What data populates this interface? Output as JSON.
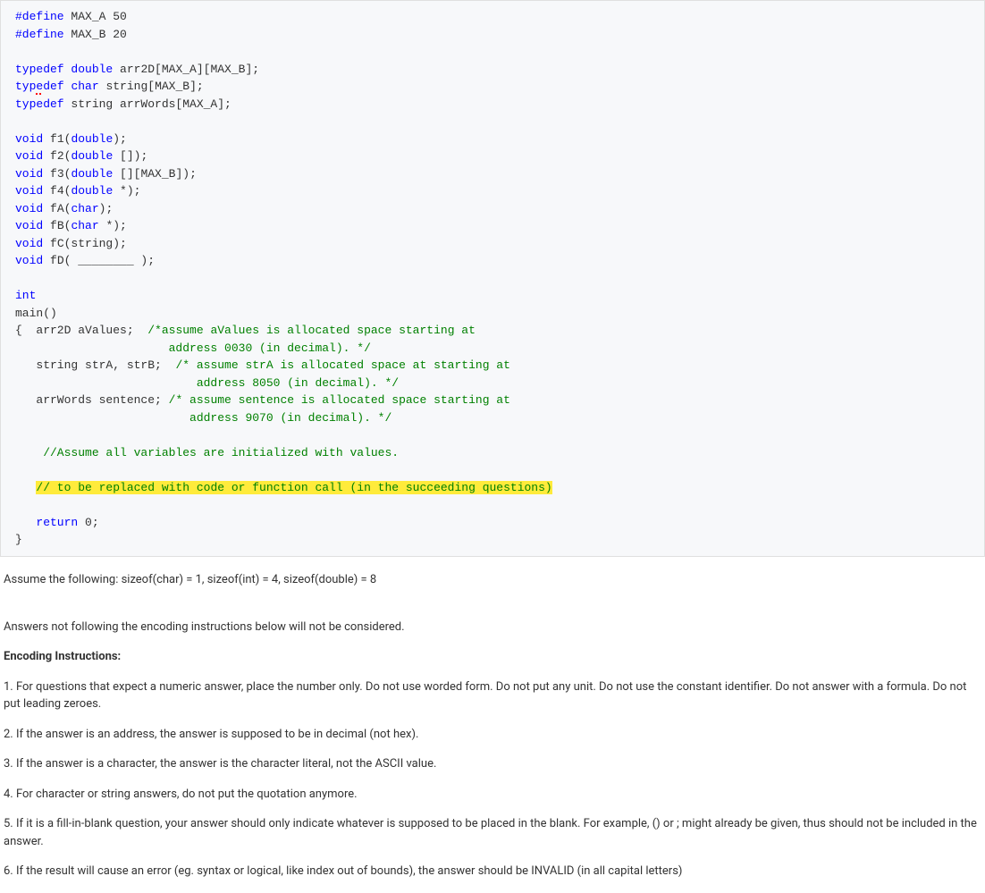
{
  "code": {
    "line1a": "#define",
    "line1b": " MAX_A 50",
    "line2a": "#define",
    "line2b": " MAX_B 20",
    "blank1": "",
    "line3a": "typedef",
    "line3b": " ",
    "line3c": "double",
    "line3d": " arr2D[MAX_A][MAX_B];",
    "line4a": "typ",
    "line4b": "e",
    "line4c": "def",
    "line4d": " ",
    "line4e": "char",
    "line4f": " string[MAX_B];",
    "line5a": "typedef",
    "line5b": " string arrWords[MAX_A];",
    "blank2": "",
    "line6a": "void",
    "line6b": " f1(",
    "line6c": "double",
    "line6d": ");",
    "line7a": "void",
    "line7b": " f2(",
    "line7c": "double",
    "line7d": " []);",
    "line8a": "void",
    "line8b": " f3(",
    "line8c": "double",
    "line8d": " [][MAX_B]);",
    "line9a": "void",
    "line9b": " f4(",
    "line9c": "double",
    "line9d": " *);",
    "line10a": "void",
    "line10b": " fA(",
    "line10c": "char",
    "line10d": ");",
    "line11a": "void",
    "line11b": " fB(",
    "line11c": "char",
    "line11d": " *);",
    "line12a": "void",
    "line12b": " fC(string);",
    "line13a": "void",
    "line13b": " fD( ________ );",
    "blank3": "",
    "line14": "int",
    "line15": "main()",
    "line16a": "{  arr2D aValues;  ",
    "line16b": "/*assume aValues is allocated space starting at",
    "line17": "                      address 0030 (in decimal). */",
    "line18a": "   string strA, strB;  ",
    "line18b": "/* assume strA is allocated space at starting at",
    "line19": "                          address 8050 (in decimal). */",
    "line20a": "   arrWords sentence; ",
    "line20b": "/* assume sentence is allocated space starting at",
    "line21": "                         address 9070 (in decimal). */",
    "blank4": "",
    "line22": "    //Assume all variables are initialized with values.",
    "blank5": "",
    "line23pre": "   ",
    "line23": "// to be replaced with code or function call (in the succeeding questions)",
    "blank6": "",
    "line24a": "   ",
    "line24b": "return",
    "line24c": " 0;",
    "line25": "}"
  },
  "text": {
    "assume": "Assume the following: sizeof(char) = 1, sizeof(int) = 4, sizeof(double) = 8",
    "warning": "Answers not following the encoding instructions below will not be considered.",
    "heading": "Encoding Instructions:",
    "inst1": "1. For questions that expect a numeric answer, place the number only. Do not use worded form. Do not put any unit. Do not use the constant identifier.  Do not answer with a formula. Do not put leading zeroes.",
    "inst2": "2. If the answer is an address, the answer is supposed to be in decimal (not hex).",
    "inst3": "3. If the answer is a character, the answer is the character literal, not the ASCII value.",
    "inst4": "4. For character or string answers, do not put the quotation anymore.",
    "inst5": "5. If it is a fill-in-blank question, your answer should only indicate whatever is supposed to be placed in the blank.  For example, () or ; might already be given, thus should not be included in the answer.",
    "inst6": "6. If the result will cause an error (eg. syntax or logical, like index out of bounds), the answer should be INVALID (in all capital letters)"
  }
}
